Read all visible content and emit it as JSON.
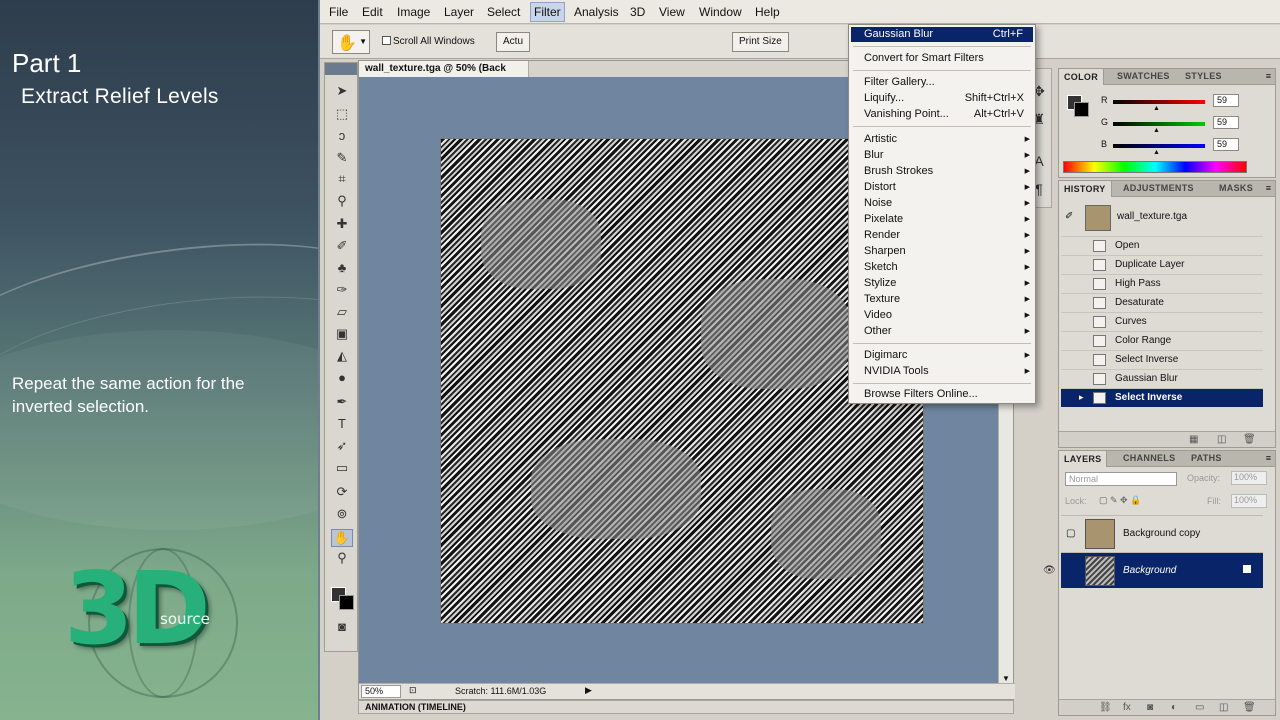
{
  "tutorial": {
    "part": "Part 1",
    "subtitle": "Extract Relief Levels",
    "body": "Repeat the same action for the inverted selection.",
    "logo_text": "3D",
    "logo_sub": "source"
  },
  "app": {
    "menu": [
      "File",
      "Edit",
      "Image",
      "Layer",
      "Select",
      "Filter",
      "Analysis",
      "3D",
      "View",
      "Window",
      "Help"
    ],
    "active_menu": "Filter"
  },
  "options_bar": {
    "scroll_all_windows": "Scroll All Windows",
    "actual_pixels": "Actu",
    "print_size": "Print Size"
  },
  "document": {
    "tab_title": "wall_texture.tga @ 50% (Back",
    "zoom": "50%",
    "scratch": "Scratch: 111.6M/1.03G",
    "animation_bar": "ANIMATION (TIMELINE)"
  },
  "filter_menu": {
    "last_filter": {
      "label": "Gaussian Blur",
      "shortcut": "Ctrl+F"
    },
    "convert_smart": "Convert for Smart Filters",
    "group1": [
      {
        "label": "Filter Gallery...",
        "shortcut": ""
      },
      {
        "label": "Liquify...",
        "shortcut": "Shift+Ctrl+X"
      },
      {
        "label": "Vanishing Point...",
        "shortcut": "Alt+Ctrl+V"
      }
    ],
    "submenus": [
      "Artistic",
      "Blur",
      "Brush Strokes",
      "Distort",
      "Noise",
      "Pixelate",
      "Render",
      "Sharpen",
      "Sketch",
      "Stylize",
      "Texture",
      "Video",
      "Other"
    ],
    "plugins": [
      "Digimarc",
      "NVIDIA Tools"
    ],
    "browse_online": "Browse Filters Online..."
  },
  "color_panel": {
    "tabs": [
      "COLOR",
      "SWATCHES",
      "STYLES"
    ],
    "channels": [
      {
        "label": "R",
        "value": "59"
      },
      {
        "label": "G",
        "value": "59"
      },
      {
        "label": "B",
        "value": "59"
      }
    ]
  },
  "history_panel": {
    "tabs": [
      "HISTORY",
      "ADJUSTMENTS",
      "MASKS"
    ],
    "snapshot_name": "wall_texture.tga",
    "states": [
      "Open",
      "Duplicate Layer",
      "High Pass",
      "Desaturate",
      "Curves",
      "Color Range",
      "Select Inverse",
      "Gaussian Blur",
      "Select Inverse"
    ],
    "active_index": 8
  },
  "layers_panel": {
    "tabs": [
      "LAYERS",
      "CHANNELS",
      "PATHS"
    ],
    "blend_mode": "Normal",
    "opacity_label": "Opacity:",
    "opacity_value": "100%",
    "lock_label": "Lock:",
    "fill_label": "Fill:",
    "fill_value": "100%",
    "layers": [
      {
        "name": "Background copy",
        "selected": false
      },
      {
        "name": "Background",
        "selected": true
      }
    ]
  },
  "colors": {
    "highlight": "#0a246a",
    "canvas_bg": "#6f85a0",
    "texture_swatch": "#a8956f"
  }
}
